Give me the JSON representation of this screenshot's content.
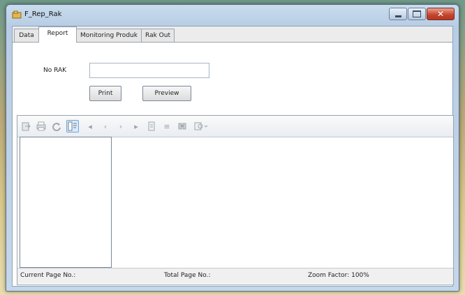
{
  "window": {
    "title": "F_Rep_Rak"
  },
  "tabs": [
    {
      "label": "Data",
      "active": false
    },
    {
      "label": "Report",
      "active": true
    },
    {
      "label": "Monitoring Produk",
      "active": false
    },
    {
      "label": "Rak Out",
      "active": false
    }
  ],
  "form": {
    "no_rak_label": "No RAK",
    "no_rak_value": "",
    "print_label": "Print",
    "preview_label": "Preview"
  },
  "viewer": {
    "toolbar_icons": [
      "export-icon",
      "print-icon",
      "refresh-icon",
      "toggle-tree-icon",
      "first-page-icon",
      "prev-page-icon",
      "next-page-icon",
      "last-page-icon",
      "goto-page-icon",
      "stop-icon",
      "search-text-icon",
      "zoom-icon"
    ],
    "status": {
      "current_page": "Current Page No.:",
      "total_page": "Total Page No.:",
      "zoom": "Zoom Factor: 100%"
    }
  },
  "colors": {
    "close_button": "#c3422c",
    "selected_tool": "#dbeaf8"
  }
}
